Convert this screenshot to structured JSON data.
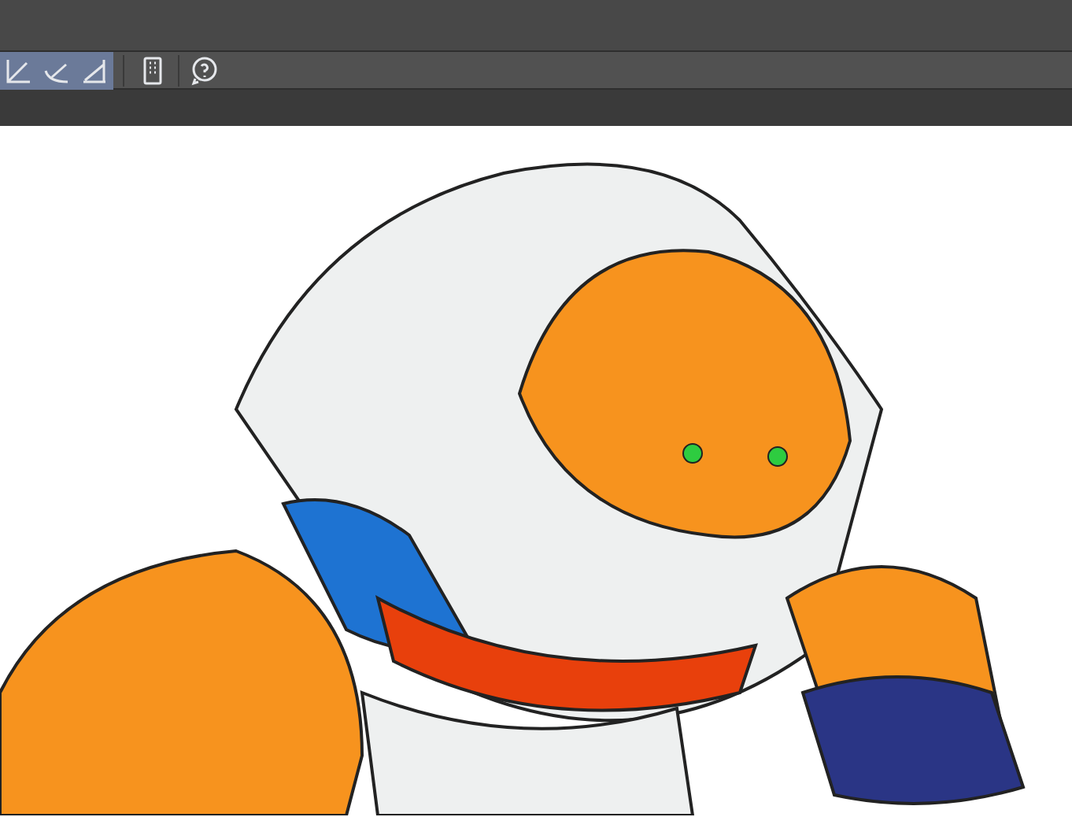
{
  "toolbar": {
    "buttons": [
      {
        "kind": "ruler",
        "selected": true
      },
      {
        "kind": "curve-ruler",
        "selected": true
      },
      {
        "kind": "angle-ruler",
        "selected": true
      },
      {
        "kind": "device",
        "selected": false
      },
      {
        "kind": "help",
        "selected": false
      }
    ]
  }
}
